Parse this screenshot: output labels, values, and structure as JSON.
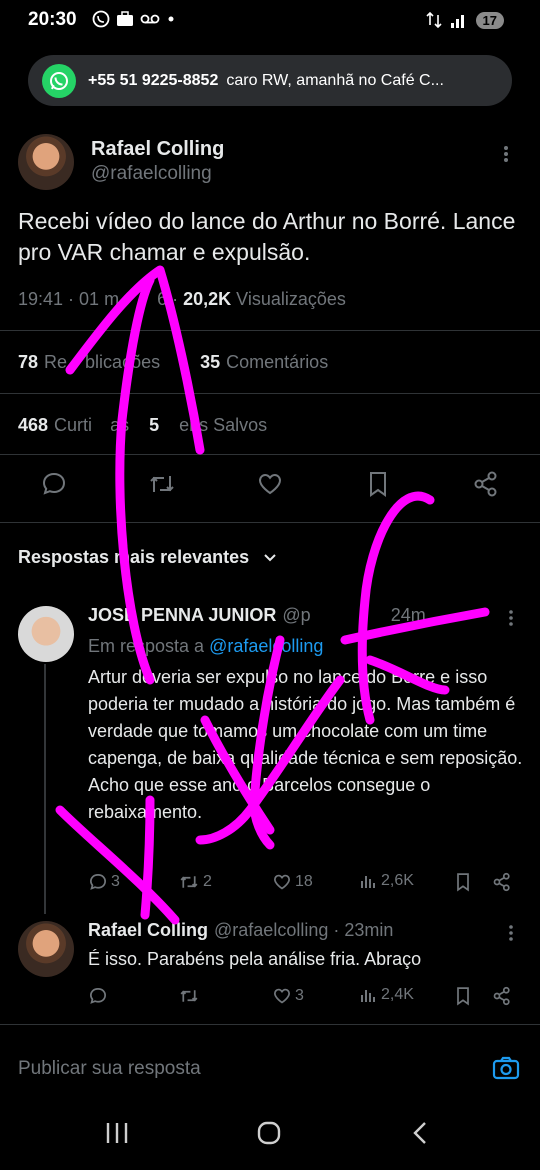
{
  "status_bar": {
    "time": "20:30",
    "left_icons": [
      "whatsapp-icon",
      "briefcase-icon",
      "voicemail-icon",
      "dot-icon"
    ],
    "right_icons": [
      "data-arrows-icon",
      "signal-icon"
    ],
    "battery": "17"
  },
  "notification": {
    "app": "WhatsApp",
    "sender": "+55 51 9225-8852",
    "preview": "caro RW, amanhã no Café C..."
  },
  "tweet": {
    "author_name": "Rafael Colling",
    "author_handle": "@rafaelcolling",
    "text": "Recebi vídeo do lance do Arthur no Borré. Lance pro VAR chamar e expulsão.",
    "time": "19:41 · 01 m",
    "time_rest": "6 · ",
    "views_count": "20,2K",
    "views_label": "Visualizações",
    "reposts_count": "78",
    "reposts_label": "Re",
    "reposts_label_rest": "blicações",
    "comments_count": "35",
    "comments_label": "Comentários",
    "likes_count": "468",
    "likes_label": "Curti",
    "likes_label_rest": "as",
    "saves_count": "5",
    "saves_label": "ens Salvos"
  },
  "replies_header": "Respostas mais relevantes",
  "replies": [
    {
      "author_name": "JOSE PENNA JUNIOR",
      "author_handle": "@p",
      "time": "24m",
      "reply_to_label": "Em resposta a",
      "reply_to_handle": "@rafaelcolling",
      "text": "Artur deveria ser expulso no lance do Borre e isso poderia ter mudado a história do jogo. Mas também é verdade que tomamos um chocolate com um time capenga, de baixa qualidade técnica e sem reposição. Acho que esse ano o Barcelos consegue o rebaixamento.",
      "comments": "3",
      "reposts": "2",
      "likes": "18",
      "views": "2,6K"
    },
    {
      "author_name": "Rafael Colling",
      "author_handle": "@rafaelcolling · 23min",
      "text": "É isso. Parabéns pela análise fria. Abraço",
      "comments": "",
      "reposts": "",
      "likes": "3",
      "views": "2,4K"
    }
  ],
  "compose_placeholder": "Publicar sua resposta",
  "annotation_color": "#ff00ff"
}
